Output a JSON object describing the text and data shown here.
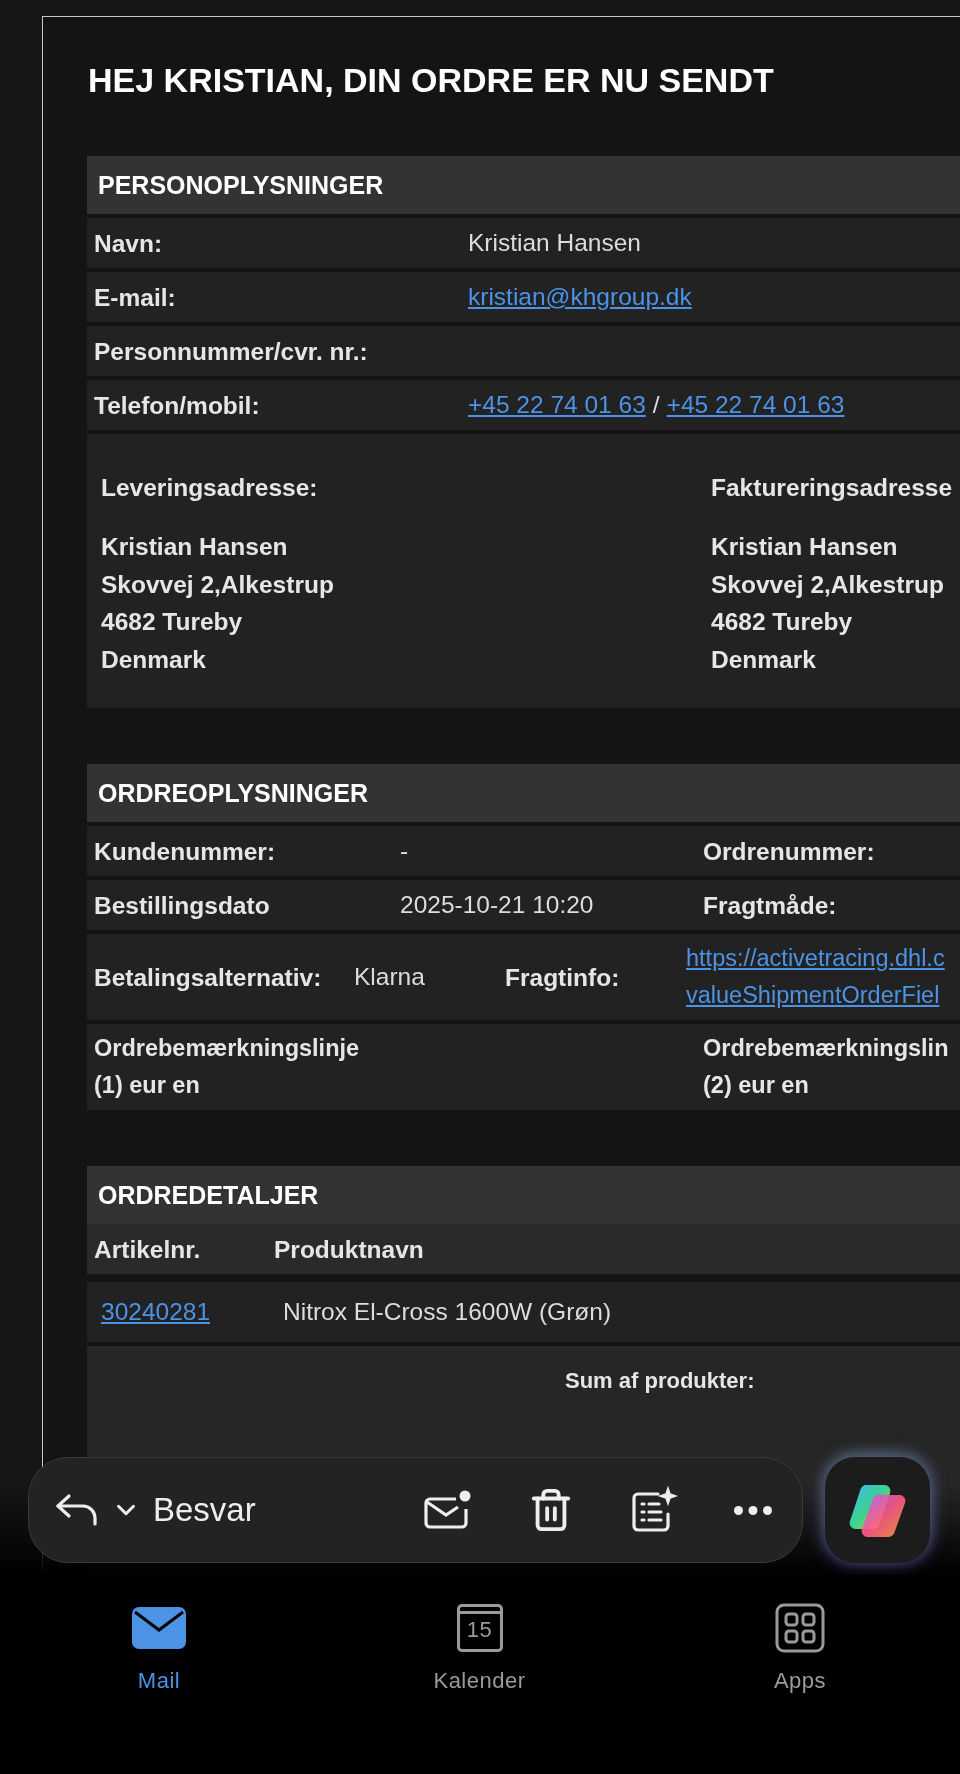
{
  "heading": "HEJ KRISTIAN, DIN ORDRE ER NU SENDT",
  "personal": {
    "title": "PERSONOPLYSNINGER",
    "rows": [
      {
        "label": "Navn:",
        "parts": [
          {
            "kind": "text",
            "text": "Kristian Hansen"
          }
        ]
      },
      {
        "label": "E-mail:",
        "parts": [
          {
            "kind": "link",
            "text": "kristian@khgroup.dk"
          }
        ]
      },
      {
        "label": "Personnummer/cvr. nr.:",
        "parts": []
      },
      {
        "label": "Telefon/mobil:",
        "parts": [
          {
            "kind": "link",
            "text": "+45 22 74 01 63"
          },
          {
            "kind": "text",
            "text": "/"
          },
          {
            "kind": "link",
            "text": "+45 22 74 01 63"
          }
        ]
      }
    ]
  },
  "addresses": [
    {
      "title": "Leveringsadresse:",
      "lines": [
        "Kristian Hansen",
        "Skovvej 2,Alkestrup",
        "4682 Tureby",
        "Denmark"
      ]
    },
    {
      "title": "Faktureringsadresse",
      "lines": [
        "Kristian Hansen",
        "Skovvej 2,Alkestrup",
        "4682 Tureby",
        "Denmark"
      ]
    }
  ],
  "order": {
    "title": "ORDREOPLYSNINGER",
    "rows": [
      {
        "kind": "three",
        "cells": [
          {
            "kind": "label",
            "lines": [
              "Kundenummer:"
            ]
          },
          {
            "kind": "value",
            "lines": [
              "-"
            ]
          },
          {
            "kind": "label",
            "lines": [
              "Ordrenummer:"
            ]
          }
        ]
      },
      {
        "kind": "three",
        "cells": [
          {
            "kind": "label",
            "lines": [
              "Bestillingsdato"
            ]
          },
          {
            "kind": "value",
            "lines": [
              "2025-10-21 10:20"
            ]
          },
          {
            "kind": "label",
            "lines": [
              "Fragtmåde:"
            ]
          }
        ]
      },
      {
        "kind": "four",
        "cells": [
          {
            "kind": "label",
            "lines": [
              "Betalingsalternativ:"
            ]
          },
          {
            "kind": "value",
            "lines": [
              "Klarna"
            ]
          },
          {
            "kind": "label",
            "lines": [
              "Fragtinfo:"
            ]
          },
          {
            "kind": "link",
            "lines": [
              "https://activetracing.dhl.c",
              "valueShipmentOrderFiel"
            ]
          }
        ]
      },
      {
        "kind": "notes",
        "cells": [
          {
            "kind": "label",
            "lines": [
              "Ordrebemærkningslinje",
              "(1) eur en"
            ]
          },
          {
            "kind": "blank"
          },
          {
            "kind": "label",
            "lines": [
              "Ordrebemærkningslin",
              "(2) eur en"
            ]
          }
        ]
      }
    ]
  },
  "details": {
    "title": "ORDREDETALJER",
    "columns": [
      "Artikelnr.",
      "Produktnavn"
    ],
    "rows": [
      {
        "article": "30240281",
        "name": "Nitrox El-Cross 1600W (Grøn)"
      }
    ],
    "summary": [
      "Sum af produkter:"
    ]
  },
  "toolbar": {
    "reply_label": "Besvar"
  },
  "tabs": [
    {
      "kind": "mail",
      "label": "Mail",
      "selected": true
    },
    {
      "kind": "calendar",
      "label": "Kalender",
      "badge": "15",
      "selected": false
    },
    {
      "kind": "apps",
      "label": "Apps",
      "selected": false
    }
  ]
}
